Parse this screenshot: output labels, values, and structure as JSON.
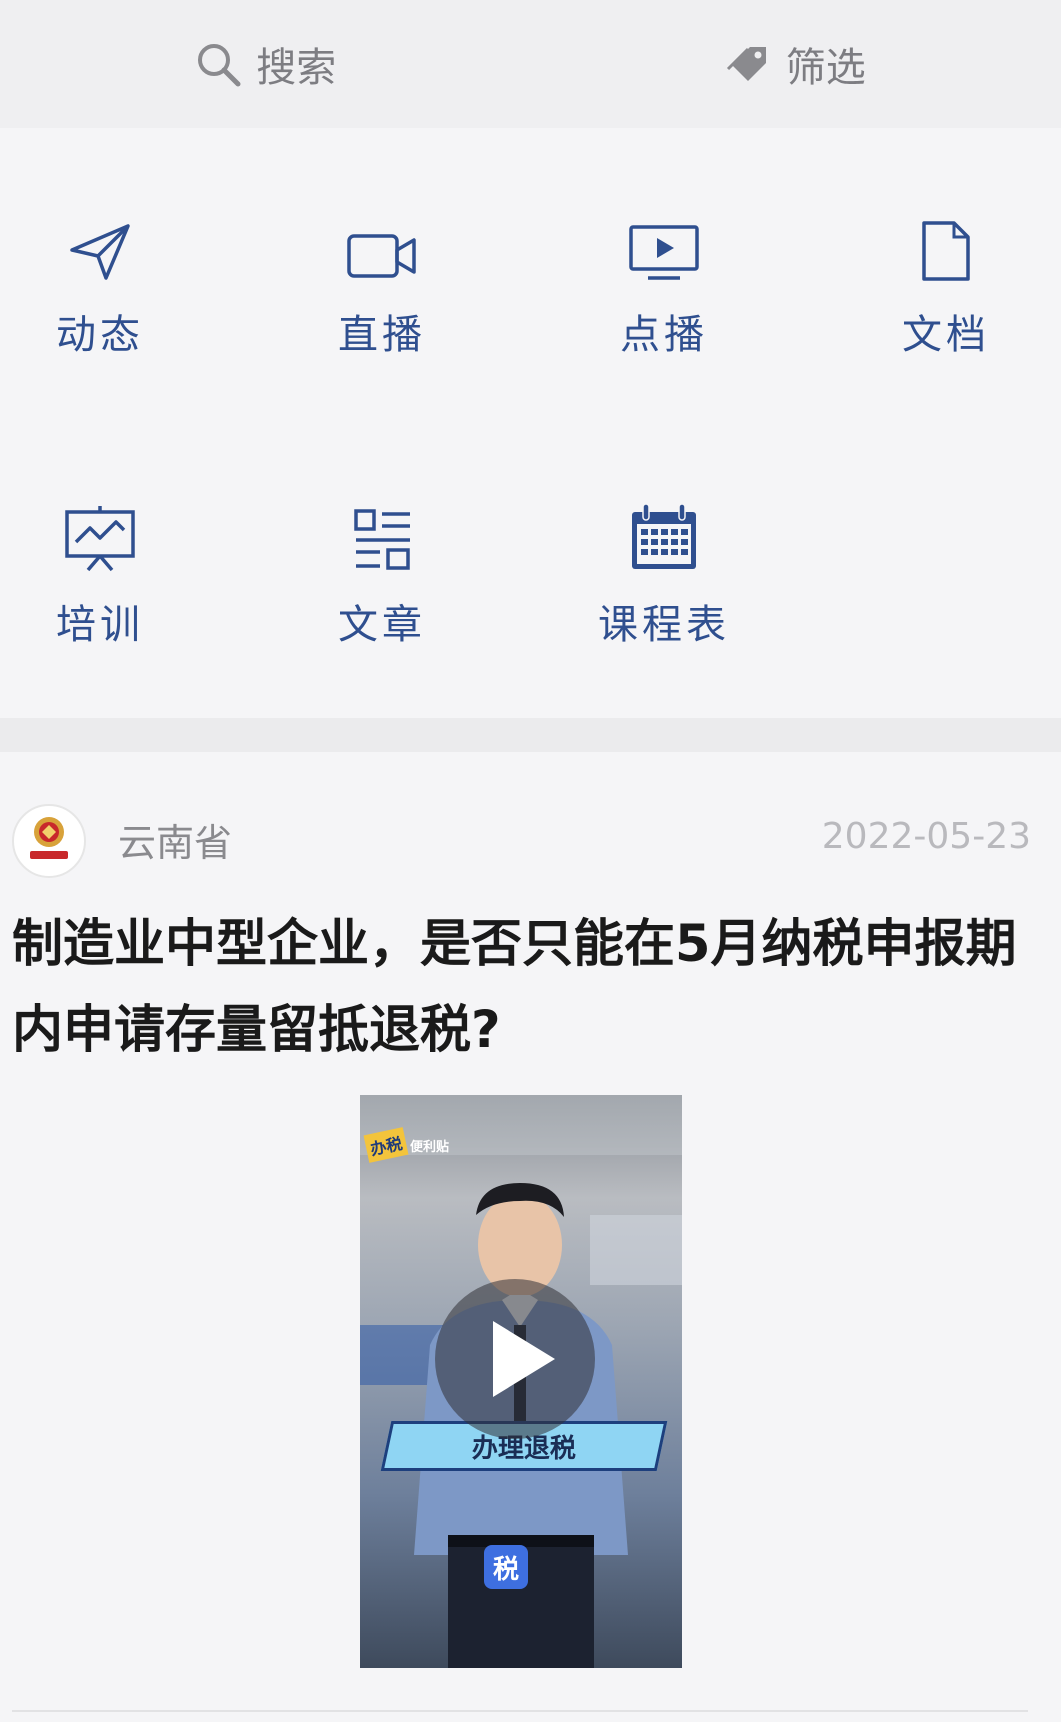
{
  "topbar": {
    "search_label": "搜索",
    "filter_label": "筛选"
  },
  "categories": [
    {
      "label": "动态",
      "icon": "send-icon"
    },
    {
      "label": "直播",
      "icon": "video-camera-icon"
    },
    {
      "label": "点播",
      "icon": "play-screen-icon"
    },
    {
      "label": "文档",
      "icon": "document-icon"
    },
    {
      "label": "培训",
      "icon": "presentation-chart-icon"
    },
    {
      "label": "文章",
      "icon": "article-list-icon"
    },
    {
      "label": "课程表",
      "icon": "calendar-icon"
    }
  ],
  "post": {
    "source": "云南省",
    "date": "2022-05-23",
    "title": "制造业中型企业，是否只能在5月纳税申报期内申请存量留抵退税?",
    "video": {
      "corner_tag_main": "办税",
      "corner_tag_sub": "便利贴",
      "banner_text": "办理退税",
      "badge_text": "税"
    }
  },
  "colors": {
    "icon_blue": "#2f4f8f",
    "label_blue": "#2f4f8f",
    "topbar_gray": "#7d7d82"
  }
}
